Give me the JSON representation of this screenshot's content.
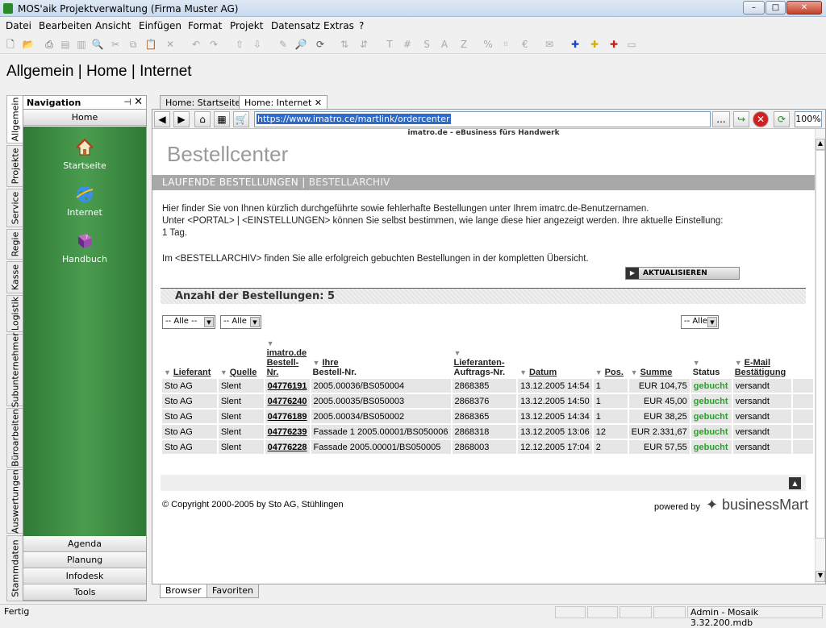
{
  "window": {
    "title": "MOS'aik Projektverwaltung (Firma Muster AG)",
    "minimize": "–",
    "maximize": "□",
    "close": "✕"
  },
  "menu": [
    "Datei",
    "Bearbeiten",
    "Ansicht",
    "Einfügen",
    "Format",
    "Projekt",
    "Datensatz",
    "Extras",
    "?"
  ],
  "toolbar": {
    "text_buttons": [
      "T",
      "#",
      "S",
      "A",
      "Z",
      "%"
    ]
  },
  "breadcrumb": {
    "part1": "Allgemein",
    "sep1": "|",
    "part2": "Home",
    "sep2": "|",
    "part3": "Internet"
  },
  "vtabs": [
    "Allgemein",
    "Projekte",
    "Service",
    "Regie",
    "Kasse",
    "Logistik",
    "Subunternehmer",
    "Büroarbeiten",
    "Auswertungen",
    "Stammdaten"
  ],
  "nav": {
    "title": "Navigation",
    "pin": "⊣",
    "close": "✕",
    "home": "Home",
    "items": [
      {
        "label": "Startseite",
        "icon": "house-icon"
      },
      {
        "label": "Internet",
        "icon": "globe-icon"
      },
      {
        "label": "Handbuch",
        "icon": "book-icon"
      }
    ],
    "bottom": [
      "Agenda",
      "Planung",
      "Infodesk",
      "Tools"
    ]
  },
  "doctabs": {
    "tab1": "Home: Startseite",
    "tab2": "Home: Internet",
    "tab2_close": "✕"
  },
  "browser": {
    "url": "https://www.imatro.ce/martlink/ordercenter",
    "dots": "...",
    "zoom": "100%",
    "site_header": "imatro.de - eBusiness fürs Handwerk",
    "page_title": "Bestellcenter",
    "subnav_active": "LAUFENDE BESTELLUNGEN",
    "subnav_sep": "|",
    "subnav_archive": "BESTELLARCHIV",
    "para1": "Hier finder Sie von Ihnen kürzlich durchgeführte sowie fehlerhafte Bestellungen unter Ihrem imatrc.de-Benutzernamen.",
    "para2": "Unter <PORTAL> | <EINSTELLUNGEN> können Sie selbst bestimmen, wie lange diese hier angezeigt werden. Ihre aktuelle Einstellung:",
    "para3": "1 Tag.",
    "para4": "Im <BESTELLARCHIV> finden Sie alle erfolgreich gebuchten Bestellungen in der kompletten Übersicht.",
    "refresh_btn": "AKTUALISIEREN",
    "count_label": "Anzahl der Bestellungen: 5",
    "filters": {
      "lieferant": "-- Alle --",
      "quelle": "-- Alle",
      "status": "-- Alle"
    },
    "columns": {
      "lieferant": "Lieferant",
      "quelle": "Quelle",
      "imatro_1": "imatro.de",
      "imatro_2": "Bestell-",
      "imatro_3": "Nr.",
      "ihre_1": "Ihre",
      "ihre_2": "Bestell-Nr.",
      "lief_1": "Lieferanten-",
      "lief_2": "Auftrags-Nr.",
      "datum": "Datum",
      "pos": "Pos.",
      "summe": "Summe",
      "status": "Status",
      "email_1": "E-Mail",
      "email_2": "Bestätigung"
    },
    "rows": [
      [
        "Sto AG",
        "Slent",
        "04776191",
        "2005.00036/BS050004",
        "2868385",
        "13.12.2005 14:54",
        "1",
        "EUR 104,75",
        "gebucht",
        "versandt"
      ],
      [
        "Sto AG",
        "Slent",
        "04776240",
        "2005.00035/BS050003",
        "2868376",
        "13.12.2005 14:50",
        "1",
        "EUR 45,00",
        "gebucht",
        "versandt"
      ],
      [
        "Sto AG",
        "Slent",
        "04776189",
        "2005.00034/BS050002",
        "2868365",
        "13.12.2005 14:34",
        "1",
        "EUR 38,25",
        "gebucht",
        "versandt"
      ],
      [
        "Sto AG",
        "Slent",
        "04776239",
        "Fassade 1 2005.00001/BS050006",
        "2868318",
        "13.12.2005 13:06",
        "12",
        "EUR 2.331,67",
        "gebucht",
        "versandt"
      ],
      [
        "Sto AG",
        "Slent",
        "04776228",
        "Fassade 2005.00001/BS050005",
        "2868003",
        "12.12.2005 17:04",
        "2",
        "EUR 57,55",
        "gebucht",
        "versandt"
      ]
    ],
    "copyright": "© Copyright 2000-2005 by Sto AG, Stühlingen",
    "powered_by": "powered by",
    "brand": "businessMart"
  },
  "bottomtabs": [
    "Browser",
    "Favoriten"
  ],
  "status": {
    "left": "Fertig",
    "right": "Admin - Mosaik 3.32.200.mdb"
  },
  "colors": {
    "green_nav": "#3f8f45",
    "status_green": "#2aa02a",
    "subnav_grey": "#a8a8a8"
  }
}
